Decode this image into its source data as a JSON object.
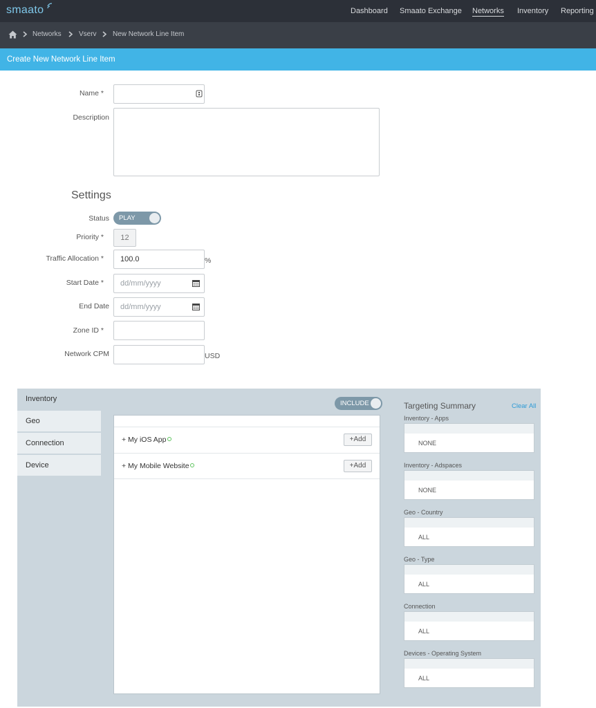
{
  "brand": {
    "logo_text": "smaato",
    "accent": "#41b4e6"
  },
  "nav": {
    "items": [
      {
        "label": "Dashboard"
      },
      {
        "label": "Smaato Exchange"
      },
      {
        "label": "Networks",
        "active": true
      },
      {
        "label": "Inventory"
      },
      {
        "label": "Reporting"
      }
    ]
  },
  "breadcrumb": {
    "home_icon": "home-icon",
    "items": [
      "Networks",
      "Vserv",
      "New Network Line Item"
    ]
  },
  "page": {
    "title": "Create New Network Line Item"
  },
  "form": {
    "name": {
      "label": "Name",
      "required": "*",
      "value": ""
    },
    "description": {
      "label": "Description",
      "value": ""
    },
    "settings_heading": "Settings",
    "status": {
      "label": "Status",
      "toggle_label": "PLAY"
    },
    "priority": {
      "label": "Priority",
      "required": "*",
      "value": "12"
    },
    "traffic": {
      "label": "Traffic Allocation",
      "required": "*",
      "value": "100.0",
      "unit": "%"
    },
    "start_date": {
      "label": "Start Date",
      "required": "*",
      "placeholder": "dd/mm/yyyy"
    },
    "end_date": {
      "label": "End Date",
      "placeholder": "dd/mm/yyyy"
    },
    "zone_id": {
      "label": "Zone ID",
      "required": "*",
      "value": ""
    },
    "network_cpm": {
      "label": "Network CPM",
      "value": "",
      "unit": "USD"
    }
  },
  "targeting": {
    "tabs": [
      "Inventory",
      "Geo",
      "Connection",
      "Device"
    ],
    "active_tab": "Inventory",
    "include_toggle": "INCLUDE",
    "items": [
      {
        "label": "+ My iOS App",
        "add": "+Add"
      },
      {
        "label": "+ My Mobile Website",
        "add": "+Add"
      }
    ],
    "summary": {
      "title": "Targeting Summary",
      "clear": "Clear All",
      "groups": [
        {
          "label": "Inventory - Apps",
          "value": "NONE"
        },
        {
          "label": "Inventory - Adspaces",
          "value": "NONE"
        },
        {
          "label": "Geo - Country",
          "value": "ALL"
        },
        {
          "label": "Geo - Type",
          "value": "ALL"
        },
        {
          "label": "Connection",
          "value": "ALL"
        },
        {
          "label": "Devices - Operating System",
          "value": "ALL"
        }
      ]
    }
  }
}
